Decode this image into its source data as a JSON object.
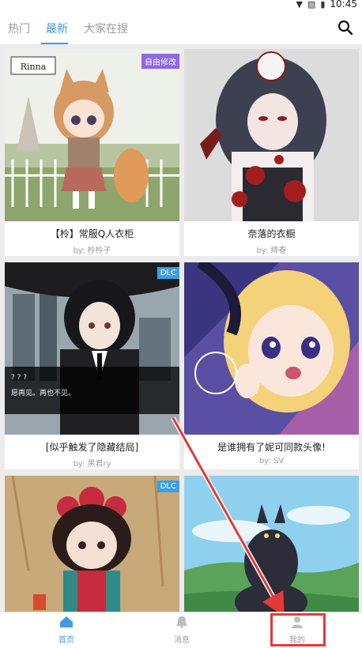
{
  "status_bar": {
    "time": "10:45"
  },
  "tabs": [
    {
      "label": "热门"
    },
    {
      "label": "最新"
    },
    {
      "label": "大家在捏"
    }
  ],
  "cards": [
    {
      "title": "【柃】常服Q人衣柜",
      "author": "by: 柃柃子",
      "badge": "自由修改",
      "logo_text": "Rinna"
    },
    {
      "title": "奈落的衣橱",
      "author": "by: 绛春",
      "badge": ""
    },
    {
      "title": "[似乎触发了隐藏结局]",
      "author": "by: 黑君ry",
      "badge": "DLC",
      "dialog_name": "? ? ?",
      "dialog_text": "愿再见。再也不见。"
    },
    {
      "title": "是谁拥有了妮可同款头像!",
      "author": "by: SV",
      "badge": ""
    },
    {
      "title": "",
      "author": "",
      "badge": "DLC"
    },
    {
      "title": "",
      "author": "",
      "badge": ""
    }
  ],
  "bottom_nav": {
    "home": "首页",
    "messages": "消息",
    "mine": "我的"
  },
  "colors": {
    "accent": "#3d9be9",
    "highlight": "#e53935",
    "badge_purple": "#8f67e8",
    "badge_blue": "#3aa0e6"
  }
}
